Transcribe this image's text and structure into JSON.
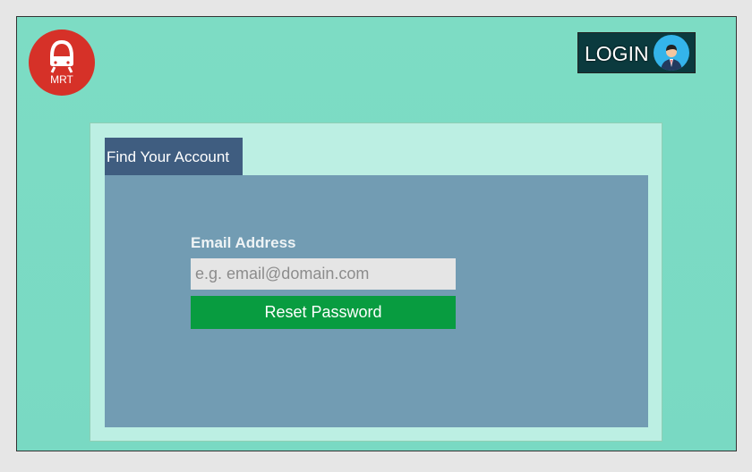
{
  "header": {
    "logo_text": "MRT",
    "login_label": "LOGIN"
  },
  "form": {
    "tab_label": "Find Your Account",
    "email_label": "Email Address",
    "email_value": "",
    "email_placeholder": "e.g. email@domain.com",
    "reset_button": "Reset Password"
  },
  "colors": {
    "background": "#7ddcc4",
    "logo": "#d63128",
    "tab": "#3f5d80",
    "content": "#729cb3",
    "button": "#089c40"
  }
}
